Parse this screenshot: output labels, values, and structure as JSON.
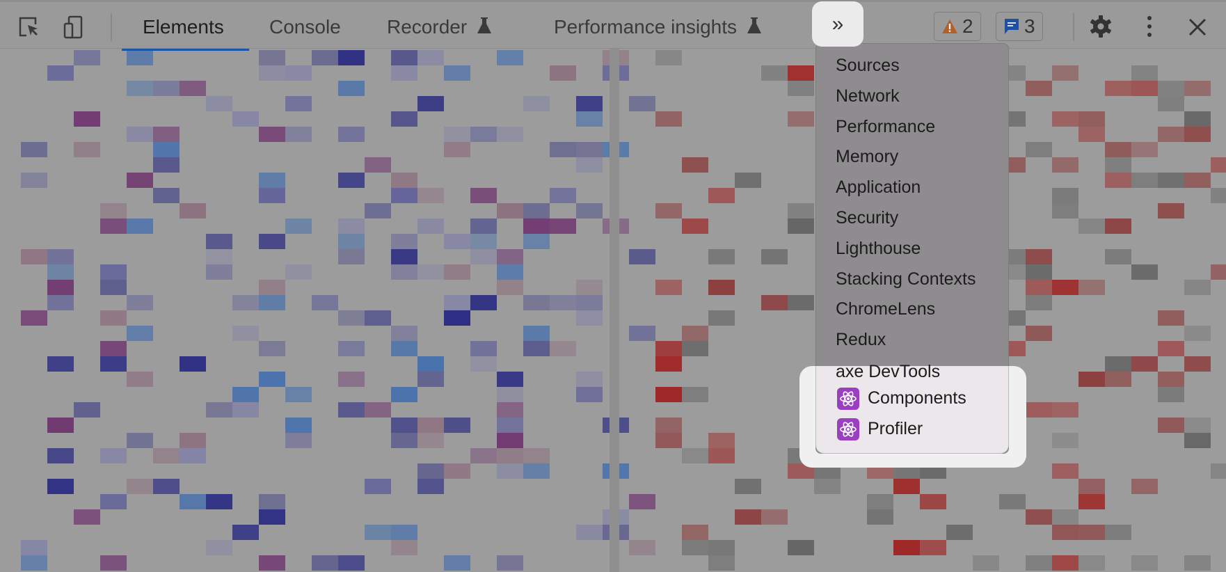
{
  "toolbar": {
    "left_icons": [
      "inspect-element-icon",
      "device-toolbar-icon"
    ],
    "tabs": [
      {
        "label": "Elements",
        "active": true
      },
      {
        "label": "Console"
      },
      {
        "label": "Recorder",
        "experimental": true
      },
      {
        "label": "Performance insights",
        "experimental": true
      }
    ],
    "more_tabs_label": "»",
    "warnings_count": "2",
    "messages_count": "3",
    "right_icons": [
      "gear-icon",
      "kebab-menu-icon",
      "close-icon"
    ],
    "colors": {
      "active_tab_underline": "#1a56a8",
      "warning": "#b0602a",
      "message": "#1f4fa0"
    }
  },
  "more_tabs_menu": {
    "items": [
      {
        "label": "Sources"
      },
      {
        "label": "Network"
      },
      {
        "label": "Performance"
      },
      {
        "label": "Memory"
      },
      {
        "label": "Application"
      },
      {
        "label": "Security"
      },
      {
        "label": "Lighthouse"
      },
      {
        "label": "Stacking Contexts"
      },
      {
        "label": "ChromeLens"
      },
      {
        "label": "Redux"
      },
      {
        "label": "axe DevTools"
      },
      {
        "label": "Components",
        "icon": "react-atom-icon",
        "highlighted": true
      },
      {
        "label": "Profiler",
        "icon": "react-atom-icon",
        "highlighted": true
      }
    ],
    "icon_color": "#9a3fc0"
  }
}
